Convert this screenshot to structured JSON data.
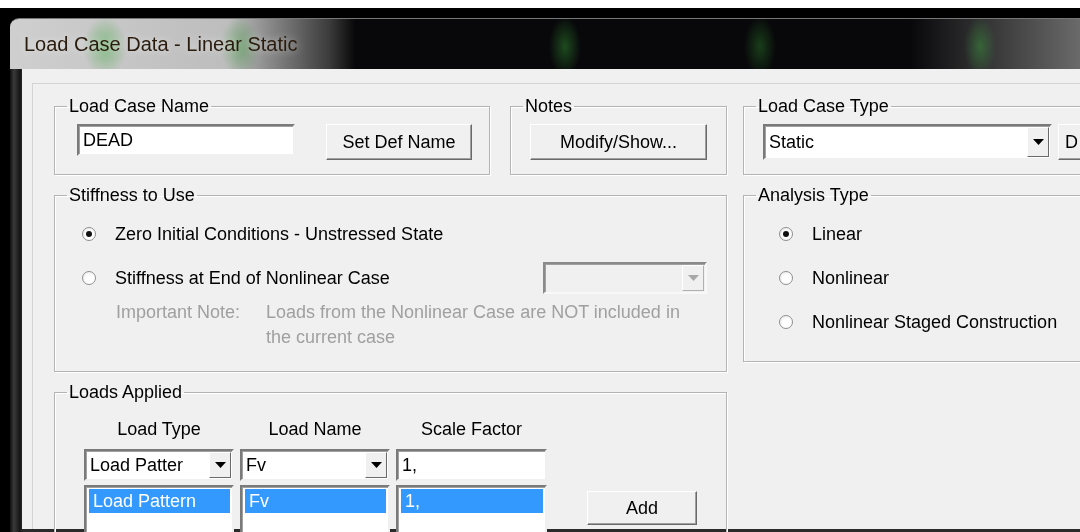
{
  "window": {
    "title": "Load Case Data - Linear Static"
  },
  "load_case_name": {
    "label": "Load Case Name",
    "value": "DEAD",
    "button": "Set Def Name"
  },
  "notes": {
    "label": "Notes",
    "button": "Modify/Show..."
  },
  "load_case_type": {
    "label": "Load Case Type",
    "value": "Static",
    "button": "D"
  },
  "stiffness": {
    "label": "Stiffness to Use",
    "options": [
      {
        "label": "Zero Initial Conditions - Unstressed State",
        "selected": true
      },
      {
        "label": "Stiffness at End of Nonlinear Case",
        "selected": false
      }
    ],
    "case_combo": {
      "disabled": true
    },
    "note_label": "Important Note:",
    "note_text": "Loads from the Nonlinear Case are NOT included in the current case"
  },
  "analysis_type": {
    "label": "Analysis Type",
    "options": [
      {
        "label": "Linear",
        "selected": true
      },
      {
        "label": "Nonlinear",
        "selected": false
      },
      {
        "label": "Nonlinear Staged Construction",
        "selected": false
      }
    ]
  },
  "loads_applied": {
    "label": "Loads Applied",
    "columns": [
      "Load Type",
      "Load Name",
      "Scale Factor"
    ],
    "entry": {
      "load_type": "Load Patter",
      "load_name": "Fv",
      "scale_factor": "1,"
    },
    "rows": [
      {
        "load_type": "Load Pattern",
        "load_name": "Fv",
        "scale_factor": "1,",
        "selected": true
      }
    ],
    "add_button": "Add"
  }
}
